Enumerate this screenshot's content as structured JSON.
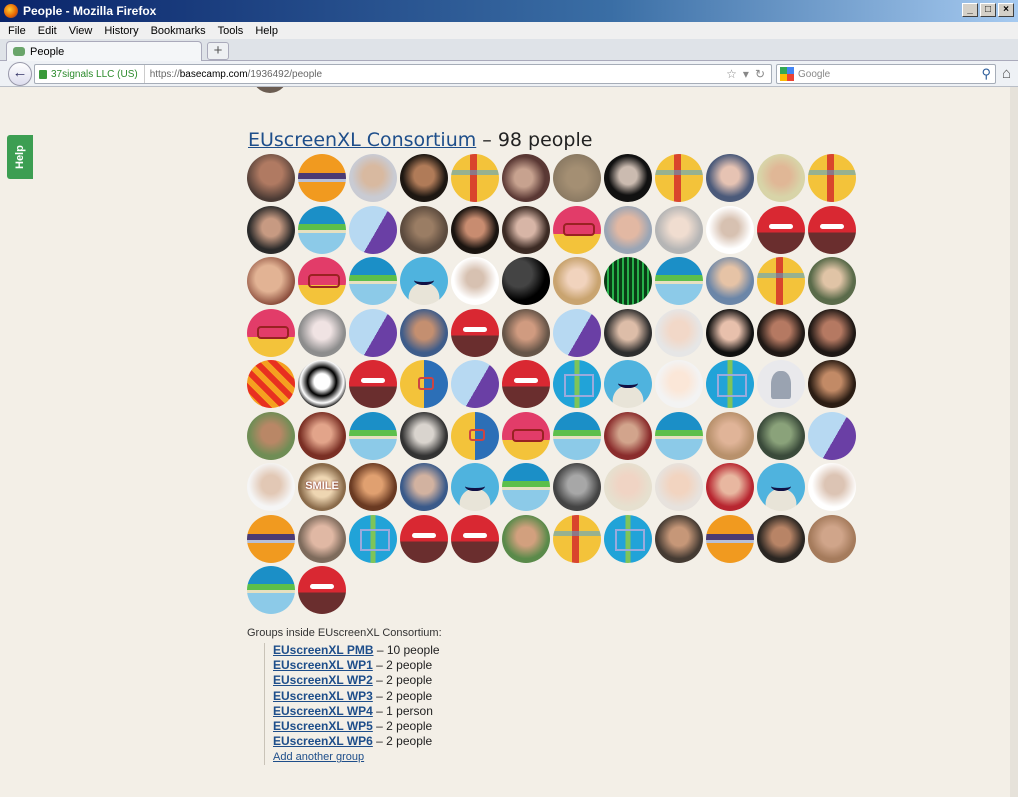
{
  "window": {
    "title": "People - Mozilla Firefox"
  },
  "menu": [
    "File",
    "Edit",
    "View",
    "History",
    "Bookmarks",
    "Tools",
    "Help"
  ],
  "tab": {
    "label": "People"
  },
  "addressbar": {
    "identity": "37signals LLC (US)",
    "url_prefix": "https://",
    "url_domain": "basecamp.com",
    "url_path": "/1936492/people"
  },
  "search": {
    "placeholder": "Google"
  },
  "help_tab": "Help",
  "group": {
    "name": "EUscreenXL Consortium",
    "count_text": " – 98 people"
  },
  "avatars": [
    "p1",
    "orange",
    "p2",
    "p3",
    "yellowline",
    "p4",
    "p5",
    "p6",
    "yellowline",
    "p7",
    "p8",
    "yellowline",
    "p9",
    "ufo",
    "lightpurple",
    "p10",
    "p11",
    "p12",
    "pinkglasses",
    "p13",
    "p14",
    "p16",
    "redsmile",
    "redsmile",
    "p15",
    "pinkglasses",
    "ufo",
    "bluesmile",
    "p16",
    "p17",
    "p18",
    "p19",
    "ufo",
    "p20",
    "yellowline",
    "p21",
    "pinkglasses",
    "p22",
    "lightpurple",
    "p23",
    "redsmile",
    "p24",
    "lightpurple",
    "p25",
    "p26",
    "p27",
    "p28",
    "p28",
    "p29",
    "p30",
    "redsmile",
    "halfblue",
    "lightpurple",
    "redsmile",
    "blueboxes",
    "bluesmile",
    "p31",
    "blueboxes",
    "silhouette",
    "p32",
    "p33",
    "p34",
    "ufo",
    "p35",
    "halfblue",
    "pinkglasses",
    "ufo",
    "p36",
    "ufo",
    "p37",
    "p38",
    "lightpurple",
    "p39",
    "smile",
    "p41",
    "p42",
    "bluesmile",
    "ufo",
    "p43",
    "p44",
    "p45",
    "p46",
    "bluesmile",
    "p47",
    "orange",
    "p48",
    "blueboxes",
    "redsmile",
    "redsmile",
    "p49",
    "yellowline",
    "blueboxes",
    "p50",
    "orange",
    "p51",
    "p52",
    "ufo",
    "redsmile"
  ],
  "smile_text": "SMILE",
  "groups_inside_title": "Groups inside EUscreenXL Consortium:",
  "subgroups": [
    {
      "name": "EUscreenXL PMB",
      "count": " – 10 people"
    },
    {
      "name": "EUscreenXL WP1",
      "count": " – 2 people"
    },
    {
      "name": "EUscreenXL WP2",
      "count": " – 2 people"
    },
    {
      "name": "EUscreenXL WP3",
      "count": " – 2 people"
    },
    {
      "name": "EUscreenXL WP4",
      "count": " – 1 person"
    },
    {
      "name": "EUscreenXL WP5",
      "count": " – 2 people"
    },
    {
      "name": "EUscreenXL WP6",
      "count": " – 2 people"
    }
  ],
  "add_group_label": "Add another group"
}
